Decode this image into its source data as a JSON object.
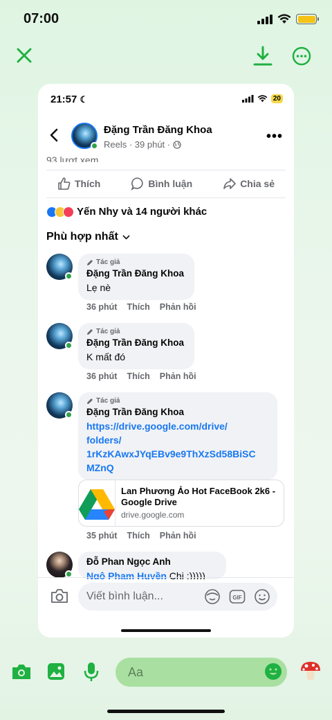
{
  "status_bar": {
    "time": "07:00"
  },
  "toolbar": {
    "close_icon": "close-icon",
    "download_icon": "download-icon",
    "more_icon": "more-options-icon"
  },
  "inner": {
    "time": "21:57",
    "battery": "20",
    "post": {
      "author": "Đặng Trần Đăng Khoa",
      "sub": "Reels · 39 phút ·",
      "views": "93 lượt xem",
      "actions": {
        "like": "Thích",
        "comment": "Bình luận",
        "share": "Chia sẻ"
      },
      "reactions_text": "Yến Nhy và 14 người khác",
      "sort_label": "Phù hợp nhất"
    },
    "comments": [
      {
        "tag": "Tác giả",
        "name": "Đặng Trần Đăng Khoa",
        "text": "Lẹ nè",
        "time": "36 phút",
        "like": "Thích",
        "reply": "Phản hồi"
      },
      {
        "tag": "Tác giả",
        "name": "Đặng Trần Đăng Khoa",
        "text": "K mất đó",
        "time": "36 phút",
        "like": "Thích",
        "reply": "Phản hồi"
      },
      {
        "tag": "Tác giả",
        "name": "Đặng Trần Đăng Khoa",
        "link_lines": [
          "https://drive.google.com/drive/",
          "folders/",
          "1rKzKAwxJYqEBv9e9ThXzSd58BiSC",
          "MZnQ"
        ],
        "time": "35 phút",
        "like": "Thích",
        "reply": "Phản hồi",
        "preview": {
          "title": "Lan Phương Ảo Hot FaceBook 2k6 - Google Drive",
          "domain": "drive.google.com"
        }
      },
      {
        "name": "Đỗ Phan Ngọc Anh",
        "mention": "Ngô Phạm Huyền",
        "text": " Chi :)))))"
      }
    ],
    "composer": {
      "placeholder": "Viết bình luận..."
    }
  },
  "bottom_bar": {
    "placeholder": "Aa"
  },
  "colors": {
    "accent": "#1fb141",
    "fb_blue": "#1877f2",
    "online": "#31a24c"
  }
}
